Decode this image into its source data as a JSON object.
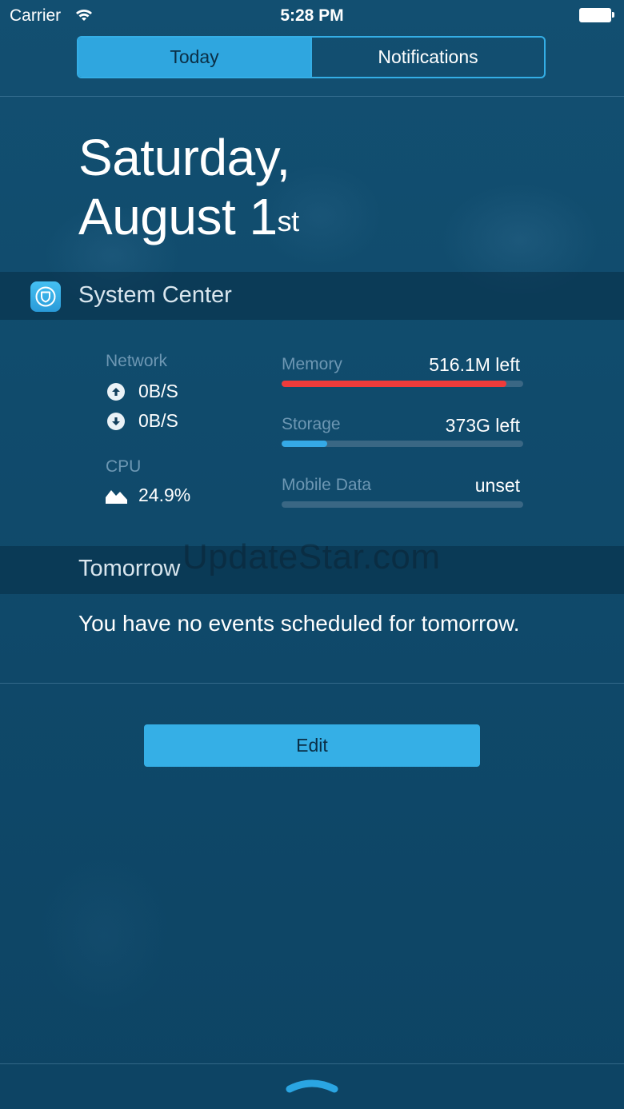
{
  "status_bar": {
    "carrier": "Carrier",
    "time": "5:28 PM",
    "icons": [
      "wifi-icon",
      "battery-icon"
    ]
  },
  "segmented_control": {
    "tabs": [
      {
        "label": "Today",
        "selected": true
      },
      {
        "label": "Notifications",
        "selected": false
      }
    ]
  },
  "date": {
    "line1": "Saturday,",
    "line2": "August 1",
    "suffix": "st"
  },
  "system_center": {
    "title": "System Center",
    "icon": "shield-icon",
    "network": {
      "label": "Network",
      "upload": "0B/S",
      "download": "0B/S"
    },
    "cpu": {
      "label": "CPU",
      "value": "24.9%"
    },
    "memory": {
      "label": "Memory",
      "value": "516.1M left",
      "fill_fraction": 0.93,
      "color": "#ef3b3b"
    },
    "storage": {
      "label": "Storage",
      "value": "373G left",
      "fill_fraction": 0.19,
      "color": "#35a9e6"
    },
    "mobile_data": {
      "label": "Mobile Data",
      "value": "unset",
      "fill_fraction": 0
    }
  },
  "tomorrow": {
    "title": "Tomorrow",
    "message": "You have no events scheduled for tomorrow."
  },
  "watermark": "UpdateStar.com",
  "edit_button": "Edit",
  "colors": {
    "background": "#0f4a6c",
    "accent": "#2fa6df",
    "memory_bar": "#ef3b3b",
    "storage_bar": "#35a9e6"
  }
}
